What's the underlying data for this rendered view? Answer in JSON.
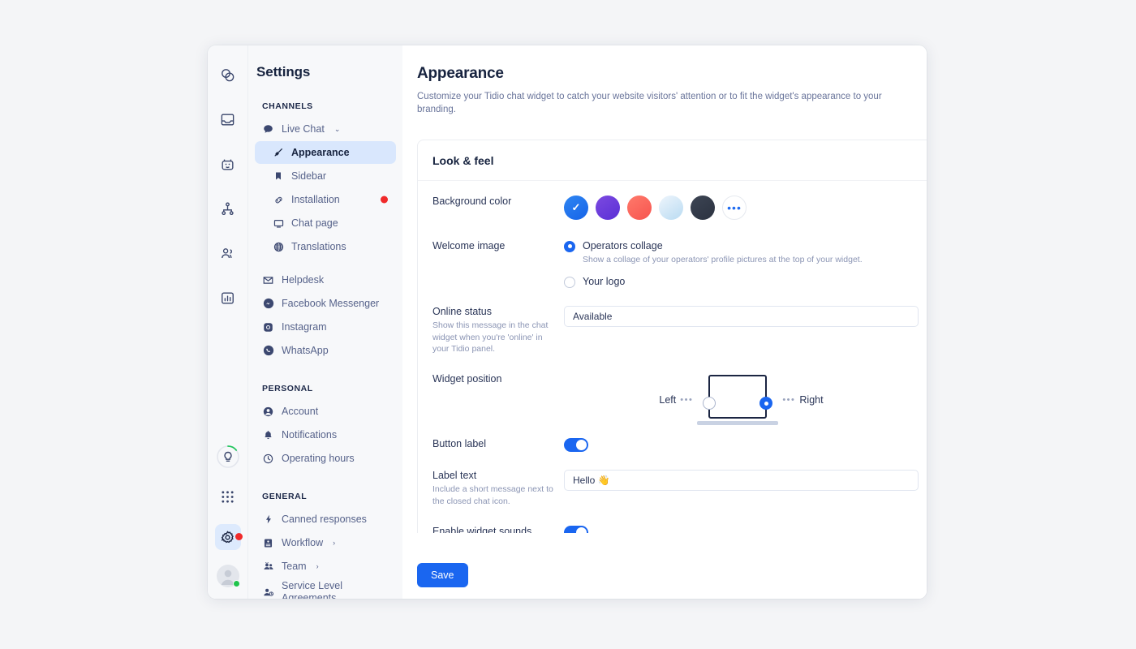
{
  "window": {
    "title": "Settings"
  },
  "rail": {
    "top_items": [
      {
        "name": "chats-icon",
        "label": "Chats"
      },
      {
        "name": "inbox-icon",
        "label": "Inbox"
      },
      {
        "name": "chatbot-icon",
        "label": "Chatbots"
      },
      {
        "name": "flows-icon",
        "label": "Flows"
      },
      {
        "name": "contacts-icon",
        "label": "Contacts"
      },
      {
        "name": "analytics-icon",
        "label": "Analytics"
      }
    ],
    "bottom_items": [
      {
        "name": "tips-bulb-icon",
        "label": "Tips"
      },
      {
        "name": "apps-grid-icon",
        "label": "Apps"
      },
      {
        "name": "settings-gear-icon",
        "label": "Settings",
        "active": true,
        "badge": true
      },
      {
        "name": "user-avatar",
        "label": "Account",
        "status": "online"
      }
    ]
  },
  "nav": {
    "sections": [
      {
        "title": "CHANNELS",
        "items": [
          {
            "label": "Live Chat",
            "icon": "chat-bubble-icon",
            "caret": "⌄",
            "expandable": true
          },
          {
            "label": "Appearance",
            "icon": "paintbrush-icon",
            "sub": true,
            "active": true
          },
          {
            "label": "Sidebar",
            "icon": "bookmark-icon",
            "sub": true
          },
          {
            "label": "Installation",
            "icon": "link-icon",
            "sub": true,
            "badge": true
          },
          {
            "label": "Chat page",
            "icon": "monitor-icon",
            "sub": true
          },
          {
            "label": "Translations",
            "icon": "globe-icon",
            "sub": true
          }
        ]
      },
      {
        "title": "",
        "items": [
          {
            "label": "Helpdesk",
            "icon": "envelope-icon"
          },
          {
            "label": "Facebook Messenger",
            "icon": "messenger-icon"
          },
          {
            "label": "Instagram",
            "icon": "instagram-icon"
          },
          {
            "label": "WhatsApp",
            "icon": "whatsapp-icon"
          }
        ]
      },
      {
        "title": "PERSONAL",
        "items": [
          {
            "label": "Account",
            "icon": "person-circle-icon"
          },
          {
            "label": "Notifications",
            "icon": "bell-icon"
          },
          {
            "label": "Operating hours",
            "icon": "clock-icon"
          }
        ]
      },
      {
        "title": "GENERAL",
        "items": [
          {
            "label": "Canned responses",
            "icon": "bolt-icon"
          },
          {
            "label": "Workflow",
            "icon": "workflow-icon",
            "caret": "›"
          },
          {
            "label": "Team",
            "icon": "team-icon",
            "caret": "›"
          },
          {
            "label": "Service Level Agreements",
            "icon": "sla-icon",
            "two_line": true
          }
        ]
      }
    ]
  },
  "page": {
    "title": "Appearance",
    "subtitle": "Customize your Tidio chat widget to catch your website visitors' attention or to fit the widget's appearance to your branding."
  },
  "card": {
    "title": "Look & feel",
    "background_color": {
      "label": "Background color",
      "selected_index": 0,
      "swatches": [
        {
          "name": "blue",
          "from": "#2f86f2",
          "to": "#1663e8",
          "selected": true
        },
        {
          "name": "purple",
          "from": "#7c4ae0",
          "to": "#5b2fd6"
        },
        {
          "name": "coral",
          "from": "#ff7a6b",
          "to": "#f7544f"
        },
        {
          "name": "light-blue",
          "from": "#e8f2fb",
          "to": "#b9dbf2"
        },
        {
          "name": "dark",
          "from": "#3d4554",
          "to": "#2c3442"
        }
      ],
      "more_label": "•••",
      "check_glyph": "✓"
    },
    "welcome_image": {
      "label": "Welcome image",
      "options": [
        {
          "label": "Operators collage",
          "hint": "Show a collage of your operators' profile pictures at the top of your widget.",
          "selected": true
        },
        {
          "label": "Your logo",
          "hint": "",
          "selected": false
        }
      ]
    },
    "online_status": {
      "label": "Online status",
      "hint": "Show this message in the chat widget when you're 'online' in your Tidio panel.",
      "value": "Available"
    },
    "widget_position": {
      "label": "Widget position",
      "left_label": "Left",
      "right_label": "Right",
      "dots": "•••",
      "selected": "Right"
    },
    "button_label": {
      "label": "Button label",
      "enabled": true
    },
    "label_text": {
      "label": "Label text",
      "hint": "Include a short message next to the closed chat icon.",
      "value": "Hello 👋"
    },
    "widget_sounds": {
      "label": "Enable widget sounds",
      "enabled": true
    }
  },
  "footer": {
    "save_label": "Save"
  }
}
